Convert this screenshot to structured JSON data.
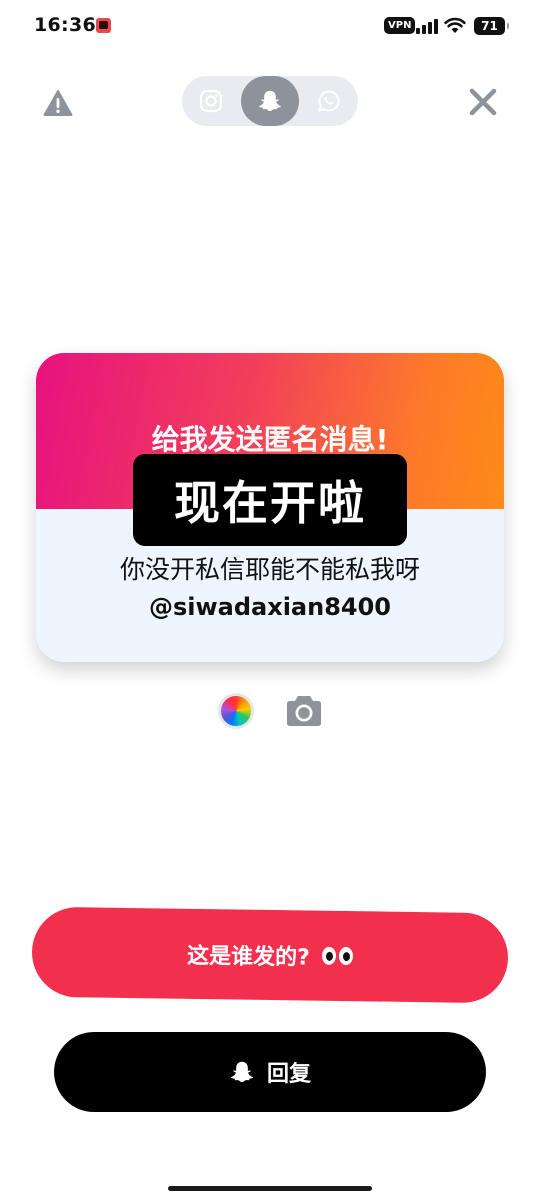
{
  "status_bar": {
    "time": "16:36",
    "vpn": "VPN",
    "battery": "71"
  },
  "toolbar": {
    "share_targets": [
      "instagram-icon",
      "snapchat-ghost-icon",
      "whatsapp-icon"
    ],
    "active_target": "snapchat-ghost-icon"
  },
  "card": {
    "title": "给我发送匿名消息!",
    "highlight": "现在开啦",
    "message": "你没开私信耶能不能私我呀",
    "handle": "@siwadaxian8400"
  },
  "buttons": {
    "primary_label": "这是谁发的?",
    "reply_label": "回复"
  },
  "colors": {
    "primary": "#f2304d",
    "gradient_start": "#e7127f",
    "gradient_end": "#ff8a18",
    "card_bottom": "#eef5fe"
  }
}
